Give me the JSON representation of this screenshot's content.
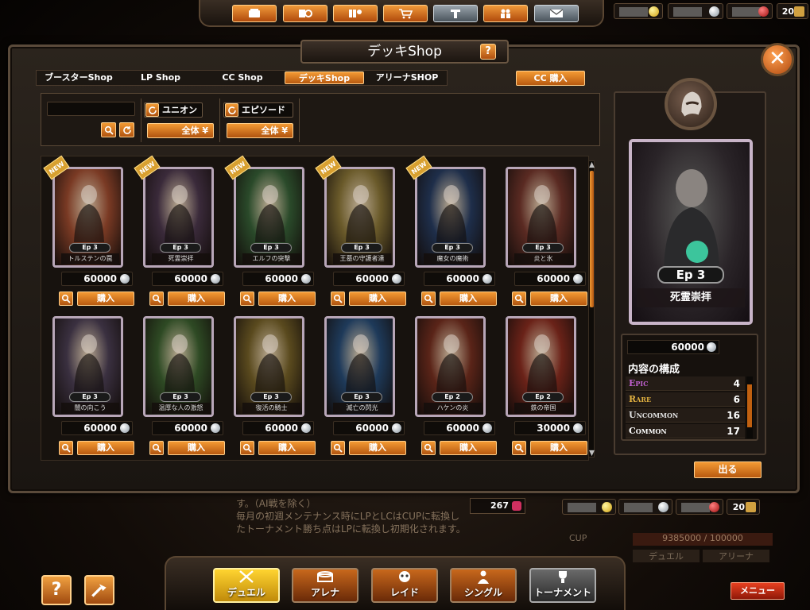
{
  "topbar": {
    "buttons": [
      "card-icon",
      "deck-edit-icon",
      "collection-icon",
      "shop-cart-icon",
      "tournament-t-icon",
      "friends-icon",
      "mail-icon"
    ],
    "resources_top_count": "20",
    "resources_bottom_count": "20"
  },
  "window": {
    "title": "デッキShop",
    "help": "?"
  },
  "tabs": [
    {
      "label": "ブースターShop"
    },
    {
      "label": "LP Shop"
    },
    {
      "label": "CC Shop"
    },
    {
      "label": "デッキShop",
      "active": true
    },
    {
      "label": "アリーナSHOP"
    }
  ],
  "cc_buy_label": "CC 購入",
  "filter": {
    "search_value": "",
    "union_label": "ユニオン",
    "union_select": "全体",
    "episode_label": "エピソード",
    "episode_select": "全体"
  },
  "cards": [
    {
      "ep": "Ep 3",
      "name": "トルステンの罠",
      "price": "60000",
      "new": true,
      "theme": "#7a3a24"
    },
    {
      "ep": "Ep 3",
      "name": "死霊崇拝",
      "price": "60000",
      "new": true,
      "theme": "#3a2a3a"
    },
    {
      "ep": "Ep 3",
      "name": "エルフの突撃",
      "price": "60000",
      "new": true,
      "theme": "#2a4a2a"
    },
    {
      "ep": "Ep 3",
      "name": "王墓の守護者達",
      "price": "60000",
      "new": true,
      "theme": "#6a5a2a"
    },
    {
      "ep": "Ep 3",
      "name": "魔女の魔術",
      "price": "60000",
      "new": true,
      "theme": "#1e2e4a"
    },
    {
      "ep": "Ep 3",
      "name": "炎と氷",
      "price": "60000",
      "new": false,
      "theme": "#5a2a22"
    },
    {
      "ep": "Ep 3",
      "name": "闇の向こう",
      "price": "60000",
      "new": false,
      "theme": "#3a3040"
    },
    {
      "ep": "Ep 3",
      "name": "温厚な人の激怒",
      "price": "60000",
      "new": false,
      "theme": "#2e4a24"
    },
    {
      "ep": "Ep 3",
      "name": "復活の騎士",
      "price": "60000",
      "new": false,
      "theme": "#5a4a1e"
    },
    {
      "ep": "Ep 3",
      "name": "滅亡の閃光",
      "price": "60000",
      "new": false,
      "theme": "#1e3a5a"
    },
    {
      "ep": "Ep 2",
      "name": "ハケンの炎",
      "price": "60000",
      "new": false,
      "theme": "#5a2418"
    },
    {
      "ep": "Ep 2",
      "name": "鉄の帝国",
      "price": "30000",
      "new": false,
      "theme": "#6a2218"
    }
  ],
  "buy_label": "購入",
  "new_label": "NEW",
  "detail": {
    "ep": "Ep 3",
    "name": "死霊崇拝",
    "price": "60000",
    "contents_title": "内容の構成",
    "rarities": [
      {
        "label": "Epic",
        "count": "4",
        "color": "#c060d0"
      },
      {
        "label": "Rare",
        "count": "6",
        "color": "#e0b040"
      },
      {
        "label": "Uncommon",
        "count": "16",
        "color": "#e0e0e0"
      },
      {
        "label": "Common",
        "count": "17",
        "color": "#ffffff"
      }
    ],
    "exit_label": "出る"
  },
  "background": {
    "notice_lines": [
      "す。（AI戦を除く）",
      "毎月の初週メンテナンス時にLPとLCはCUPに転換し",
      "たトーナメント勝ち点はLPに転換し初期化されます。"
    ],
    "points": "267",
    "cup_label": "CUP",
    "cup_value": "9385000 / 100000",
    "duel_tab": "デュエル",
    "arena_tab": "アリーナ"
  },
  "bottom_nav": [
    {
      "label": "デュエル",
      "icon": "crossed-swords-icon",
      "active": true
    },
    {
      "label": "アレナ",
      "icon": "arena-icon"
    },
    {
      "label": "レイド",
      "icon": "raid-icon"
    },
    {
      "label": "シングル",
      "icon": "single-icon"
    },
    {
      "label": "トーナメント",
      "icon": "tournament-icon",
      "grey": true
    }
  ],
  "help_label": "?",
  "menu_label": "メニュー"
}
